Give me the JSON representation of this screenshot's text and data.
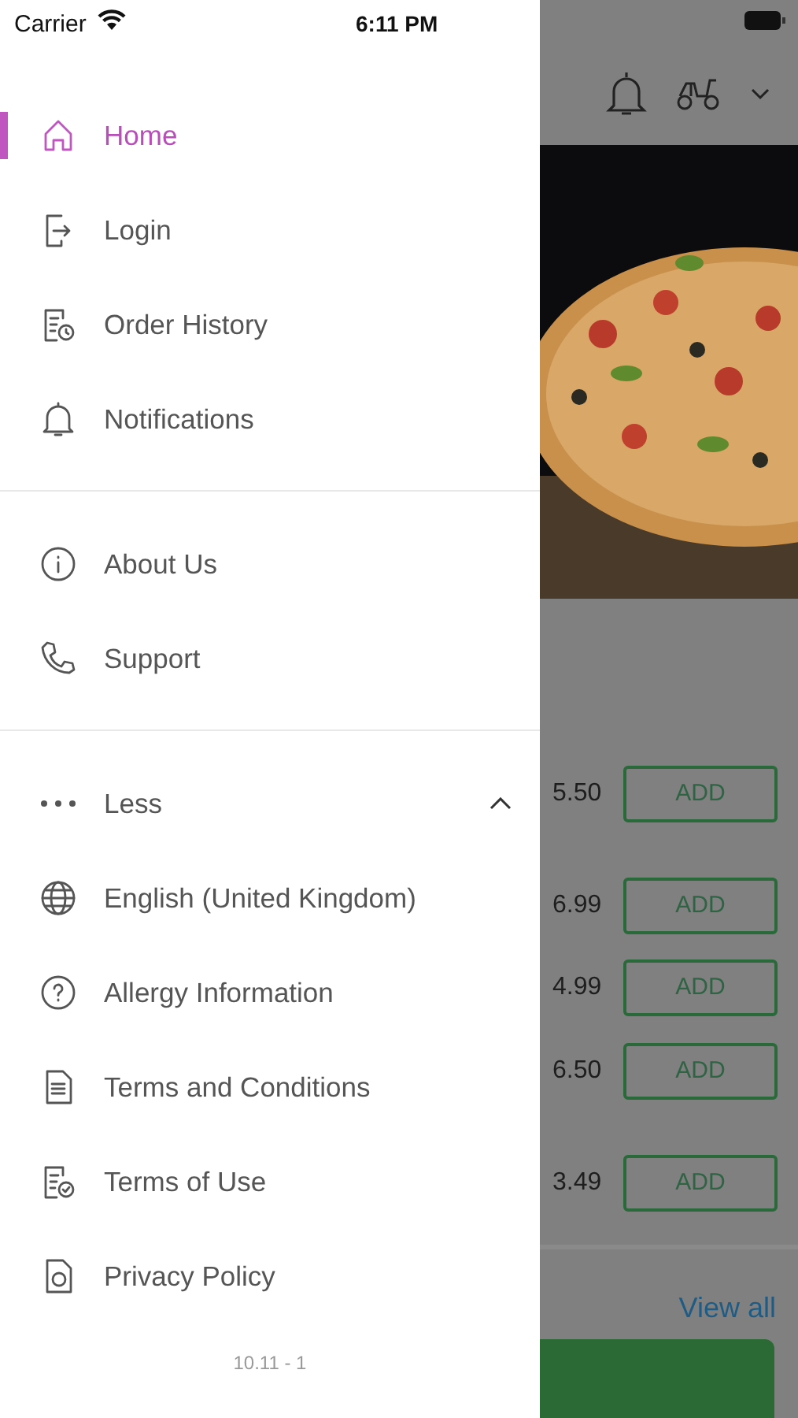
{
  "status_bar": {
    "carrier": "Carrier",
    "time": "6:11 PM"
  },
  "menu": {
    "sections": [
      {
        "items": [
          {
            "label": "Home",
            "kind": "home",
            "selected": true
          },
          {
            "label": "Login",
            "kind": "login",
            "selected": false
          },
          {
            "label": "Order History",
            "kind": "history",
            "selected": false
          },
          {
            "label": "Notifications",
            "kind": "alerts",
            "selected": false
          }
        ]
      },
      {
        "items": [
          {
            "label": "About Us",
            "kind": "info",
            "selected": false
          },
          {
            "label": "Support",
            "kind": "support",
            "selected": false
          }
        ]
      },
      {
        "toggle": {
          "label": "Less",
          "expanded": true
        },
        "items": [
          {
            "label": "English (United Kingdom)",
            "kind": "language",
            "selected": false
          },
          {
            "label": "Allergy Information",
            "kind": "help",
            "selected": false
          },
          {
            "label": "Terms and Conditions",
            "kind": "document",
            "selected": false
          },
          {
            "label": "Terms of Use",
            "kind": "terms",
            "selected": false
          },
          {
            "label": "Privacy Policy",
            "kind": "privacy",
            "selected": false
          }
        ]
      }
    ],
    "version": "10.11 - 1"
  },
  "background": {
    "products": [
      {
        "price": "5.50",
        "button": "ADD"
      },
      {
        "price": "6.99",
        "button": "ADD"
      },
      {
        "price": "4.99",
        "button": "ADD"
      },
      {
        "price": "6.50",
        "button": "ADD"
      },
      {
        "price": "3.49",
        "button": "ADD"
      }
    ],
    "view_all": "View all"
  }
}
